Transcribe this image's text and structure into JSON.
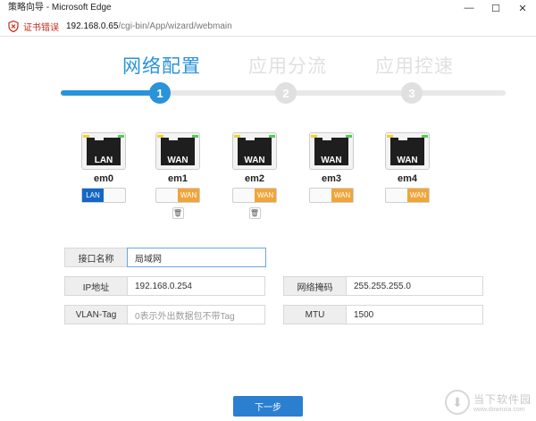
{
  "window": {
    "title": "策略向导 - Microsoft Edge",
    "minimize_glyph": "—",
    "maximize_glyph": "☐",
    "close_glyph": "✕"
  },
  "address_bar": {
    "cert_error": "证书错误",
    "url_host": "192.168.0.65",
    "url_path": "/cgi-bin/App/wizard/webmain"
  },
  "steps": [
    {
      "title": "网络配置",
      "number": "1",
      "active": true
    },
    {
      "title": "应用分流",
      "number": "2",
      "active": false
    },
    {
      "title": "应用控速",
      "number": "3",
      "active": false
    }
  ],
  "progress": {
    "fraction": 0.23
  },
  "ports": [
    {
      "name": "em0",
      "type": "LAN",
      "mode": "LAN",
      "deletable": false
    },
    {
      "name": "em1",
      "type": "WAN",
      "mode": "WAN",
      "deletable": true
    },
    {
      "name": "em2",
      "type": "WAN",
      "mode": "WAN",
      "deletable": true
    },
    {
      "name": "em3",
      "type": "WAN",
      "mode": "WAN",
      "deletable": false
    },
    {
      "name": "em4",
      "type": "WAN",
      "mode": "WAN",
      "deletable": false
    }
  ],
  "form": {
    "iface_name_label": "接口名称",
    "iface_name_value": "局域网",
    "ip_label": "IP地址",
    "ip_value": "192.168.0.254",
    "mask_label": "网络掩码",
    "mask_value": "255.255.255.0",
    "vlan_label": "VLAN-Tag",
    "vlan_placeholder": "0表示外出数据包不带Tag",
    "mtu_label": "MTU",
    "mtu_value": "1500"
  },
  "next_button": "下一步",
  "watermark": {
    "cn": "当下软件园",
    "en": "www.downxia.com"
  },
  "colors": {
    "accent": "#2a93d9",
    "lan": "#1467c6",
    "wan": "#f0a53a",
    "error": "#c42b1c"
  }
}
